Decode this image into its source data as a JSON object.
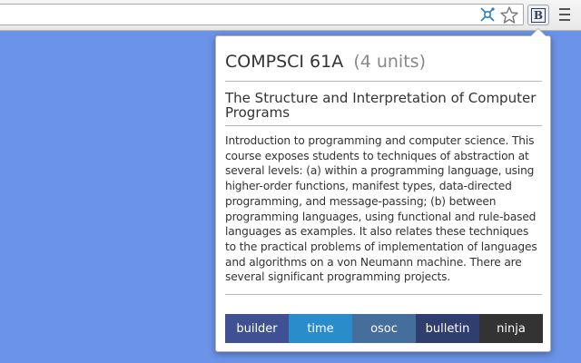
{
  "course": {
    "code": "COMPSCI 61A",
    "units": "(4 units)",
    "title": "The Structure and Interpretation of Computer Programs",
    "description": "Introduction to programming and computer science. This course exposes students to techniques of abstraction at several levels: (a) within a programming language, using higher-order functions, manifest types, data-directed programming, and message-passing; (b) between programming languages, using functional and rule-based languages as examples. It also relates these techniques to the practical problems of implementation of languages and algorithms on a von Neumann machine. There are several significant programming projects."
  },
  "extension": {
    "badge": "B"
  },
  "tabs": [
    {
      "label": "builder",
      "color": "#3f5192"
    },
    {
      "label": "time",
      "color": "#2a8ccb"
    },
    {
      "label": "osoc",
      "color": "#456e9c"
    },
    {
      "label": "bulletin",
      "color": "#2f3e6e"
    },
    {
      "label": "ninja",
      "color": "#333333"
    }
  ],
  "icons": {
    "extension_a": "satellite-icon",
    "star": "star-icon",
    "menu": "menu-icon"
  }
}
